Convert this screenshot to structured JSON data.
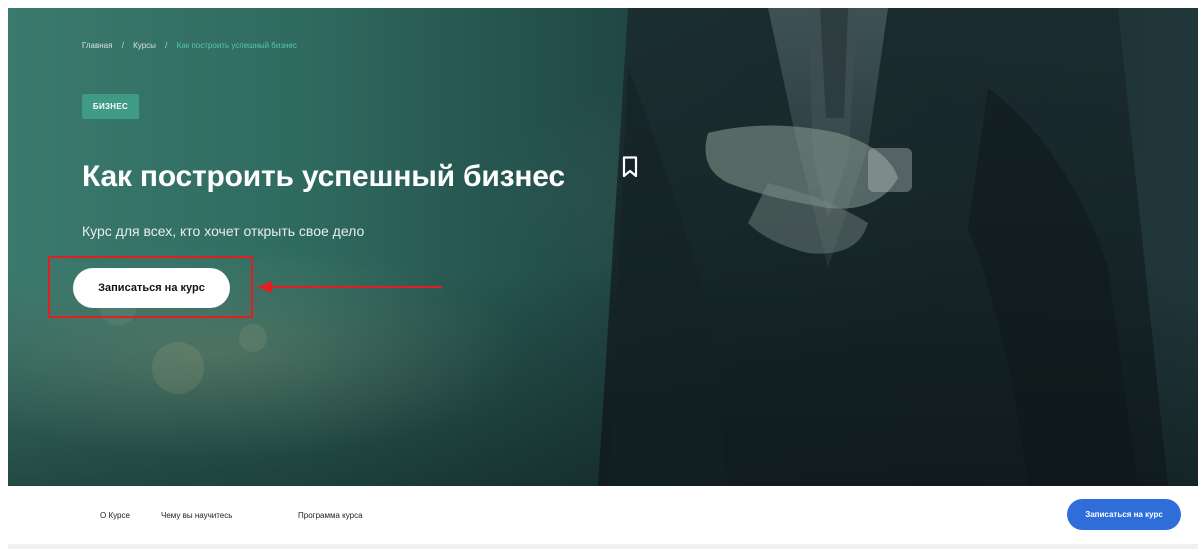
{
  "breadcrumb": {
    "home": "Главная",
    "separator": "/",
    "courses": "Курсы",
    "current": "Как построить успешный бизнес"
  },
  "hero": {
    "tag": "БИЗНЕС",
    "title": "Как построить успешный бизнес",
    "subtitle": "Курс для всех, кто хочет открыть свое дело",
    "enroll_label": "Записаться на курс",
    "bookmark_icon": "bookmark-icon"
  },
  "nav": {
    "items": [
      {
        "label": "О Курсе"
      },
      {
        "label": "Чему вы научитесь"
      },
      {
        "label": "Программа курса"
      }
    ],
    "enroll_label": "Записаться на курс"
  },
  "colors": {
    "accent_teal": "#58c6b2",
    "tag_bg": "#3f9a86",
    "primary_blue": "#2f6ed8",
    "annotation_red": "#e02020"
  }
}
